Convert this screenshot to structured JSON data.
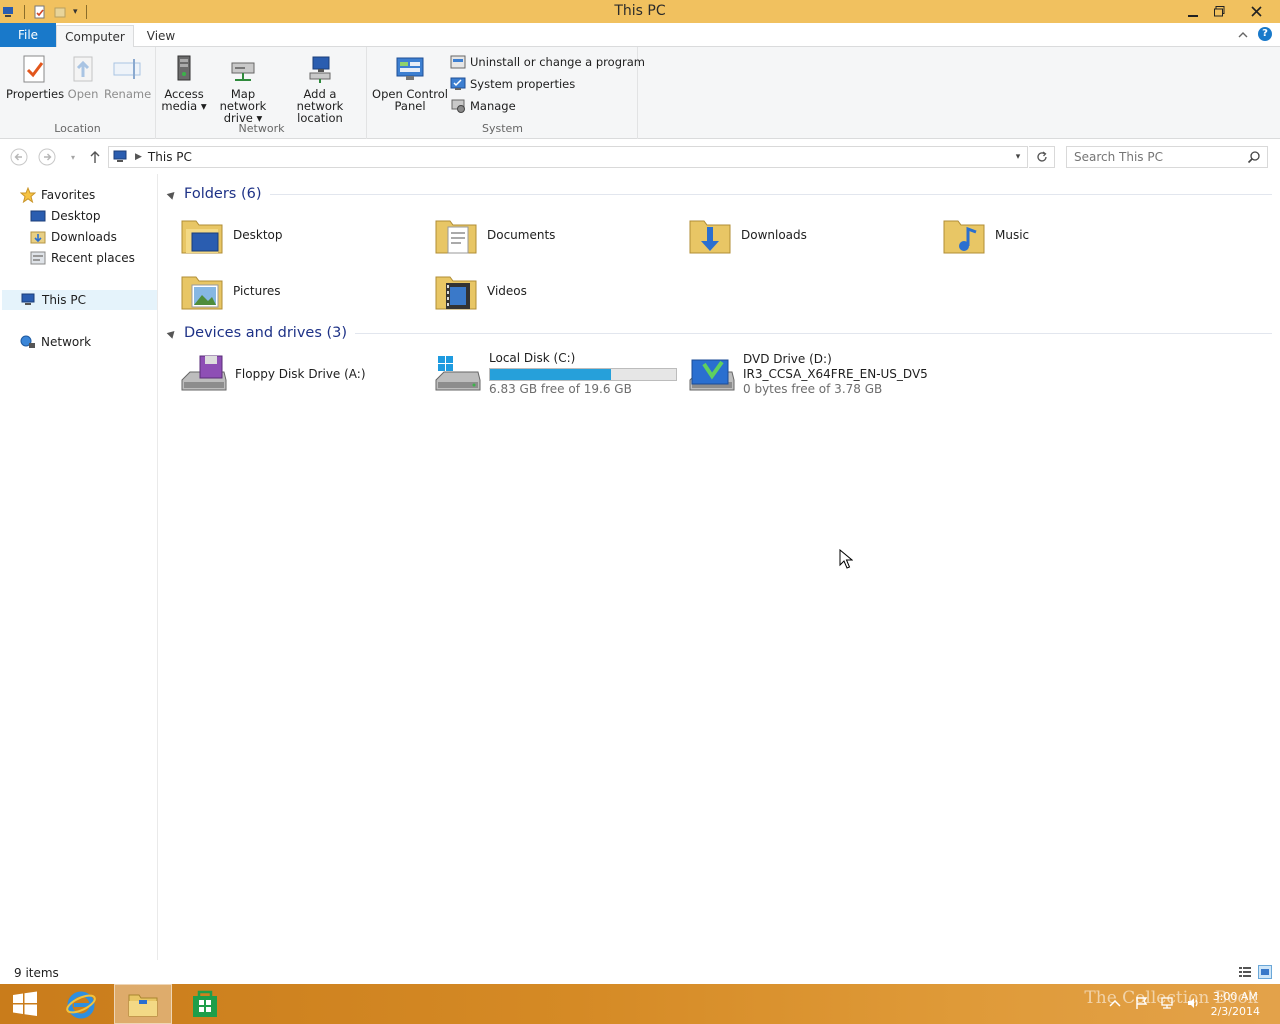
{
  "window": {
    "title": "This PC"
  },
  "ribbon": {
    "tabs": {
      "file": "File",
      "computer": "Computer",
      "view": "View"
    },
    "location": {
      "label": "Location",
      "properties": "Properties",
      "open": "Open",
      "rename": "Rename"
    },
    "network": {
      "label": "Network",
      "access_media_1": "Access",
      "access_media_2": "media ▾",
      "map_drive_1": "Map network",
      "map_drive_2": "drive ▾",
      "add_location_1": "Add a network",
      "add_location_2": "location"
    },
    "system": {
      "label": "System",
      "control_panel_1": "Open Control",
      "control_panel_2": "Panel",
      "uninstall": "Uninstall or change a program",
      "system_properties": "System properties",
      "manage": "Manage"
    }
  },
  "address": {
    "crumb": "This PC"
  },
  "search": {
    "placeholder": "Search This PC"
  },
  "navpane": {
    "favorites": "Favorites",
    "desktop": "Desktop",
    "downloads": "Downloads",
    "recent": "Recent places",
    "this_pc": "This PC",
    "network": "Network"
  },
  "folders": {
    "header": "Folders (6)",
    "items": [
      {
        "name": "Desktop"
      },
      {
        "name": "Documents"
      },
      {
        "name": "Downloads"
      },
      {
        "name": "Music"
      },
      {
        "name": "Pictures"
      },
      {
        "name": "Videos"
      }
    ]
  },
  "drives": {
    "header": "Devices and drives (3)",
    "floppy": {
      "name": "Floppy Disk Drive (A:)"
    },
    "local": {
      "name": "Local Disk (C:)",
      "free": "6.83 GB free of 19.6 GB",
      "used_fraction": 0.65
    },
    "dvd": {
      "name": "DVD Drive (D:)",
      "label": "IR3_CCSA_X64FRE_EN-US_DV5",
      "free": "0 bytes free of 3.78 GB"
    }
  },
  "status": {
    "count": "9 items"
  },
  "taskbar": {
    "watermark": "The Collection Book",
    "time": "3:00 AM",
    "date": "2/3/2014"
  },
  "colors": {
    "titlebar": "#f1c15f",
    "file_tab": "#1979ca",
    "drive_bar": "#26a0da",
    "taskbar": "#d58a25"
  }
}
